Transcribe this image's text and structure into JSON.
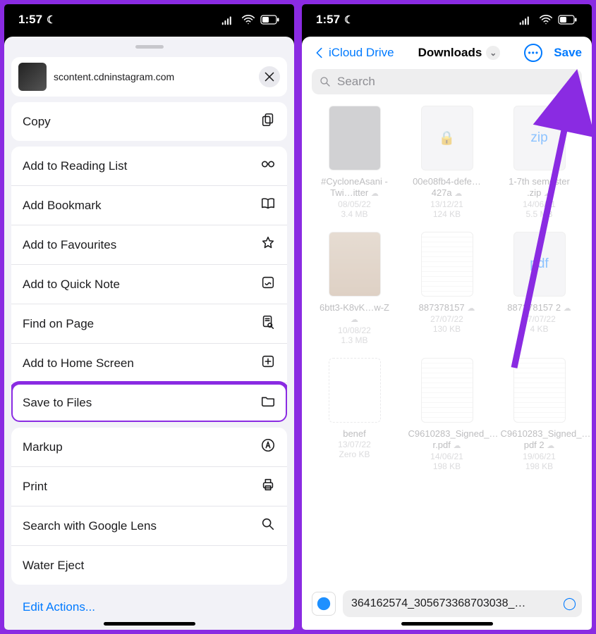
{
  "statusbar": {
    "time": "1:57"
  },
  "share": {
    "url": "scontent.cdninstagram.com",
    "copy": "Copy",
    "readingList": "Add to Reading List",
    "addBookmark": "Add Bookmark",
    "addFavourites": "Add to Favourites",
    "quickNote": "Add to Quick Note",
    "findOnPage": "Find on Page",
    "addHome": "Add to Home Screen",
    "saveFiles": "Save to Files",
    "markup": "Markup",
    "print": "Print",
    "lens": "Search with Google Lens",
    "waterEject": "Water Eject",
    "editActions": "Edit Actions..."
  },
  "files": {
    "back": "iCloud Drive",
    "title": "Downloads",
    "save": "Save",
    "searchPlaceholder": "Search",
    "items": [
      {
        "name": "#CycloneAsani - Twi…itter",
        "date": "08/05/22",
        "size": "3.4 MB"
      },
      {
        "name": "00e08fb4-defe…427a",
        "date": "13/12/21",
        "size": "124 KB"
      },
      {
        "name": "1-7th semester .zip",
        "date": "14/06/21",
        "size": "5.5 MB"
      },
      {
        "name": "6btt3-K8vK…w-Z",
        "date": "10/08/22",
        "size": "1.3 MB"
      },
      {
        "name": "887378157",
        "date": "27/07/22",
        "size": "130 KB"
      },
      {
        "name": "887378157 2",
        "date": "27/07/22",
        "size": "4 KB"
      },
      {
        "name": "benef",
        "date": "13/07/22",
        "size": "Zero KB"
      },
      {
        "name": "C9610283_Signed_…r.pdf",
        "date": "14/06/21",
        "size": "198 KB"
      },
      {
        "name": "C9610283_Signed_…pdf 2",
        "date": "19/06/21",
        "size": "198 KB"
      }
    ],
    "filename": "364162574_305673368703038_…"
  }
}
